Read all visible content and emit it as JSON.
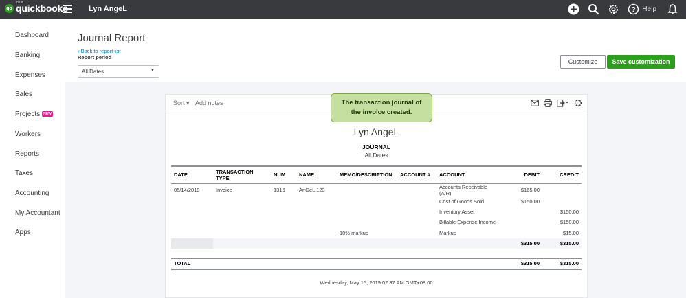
{
  "topbar": {
    "logo_intuit": "intuit",
    "logo_word": "quickbooks",
    "company_name": "Lyn AngeL",
    "help_label": "Help"
  },
  "sidebar": {
    "items": [
      {
        "label": "Dashboard"
      },
      {
        "label": "Banking"
      },
      {
        "label": "Expenses"
      },
      {
        "label": "Sales"
      },
      {
        "label": "Projects",
        "badge": "NEW"
      },
      {
        "label": "Workers"
      },
      {
        "label": "Reports"
      },
      {
        "label": "Taxes"
      },
      {
        "label": "Accounting"
      },
      {
        "label": "My Accountant"
      },
      {
        "label": "Apps"
      }
    ]
  },
  "header": {
    "title": "Journal Report",
    "back_link": "Back to report list",
    "report_period_label": "Report period",
    "period_value": "All Dates",
    "customize_label": "Customize",
    "save_label": "Save customization"
  },
  "toolbar": {
    "sort_label": "Sort",
    "add_notes_label": "Add notes"
  },
  "callout": {
    "line1": "The transaction  journal of",
    "line2": "the invoice created."
  },
  "report": {
    "company": "Lyn AngeL",
    "title": "JOURNAL",
    "dates": "All Dates",
    "columns": [
      "DATE",
      "TRANSACTION TYPE",
      "NUM",
      "NAME",
      "MEMO/DESCRIPTION",
      "ACCOUNT #",
      "ACCOUNT",
      "DEBIT",
      "CREDIT"
    ],
    "rows": [
      {
        "date": "05/14/2019",
        "type": "Invoice",
        "num": "1316",
        "name": "AnGeL 123",
        "memo": "",
        "acct_no": "",
        "account": "Accounts Receivable (A/R)",
        "debit": "$165.00",
        "credit": ""
      },
      {
        "date": "",
        "type": "",
        "num": "",
        "name": "",
        "memo": "",
        "acct_no": "",
        "account": "Cost of Goods Sold",
        "debit": "$150.00",
        "credit": ""
      },
      {
        "date": "",
        "type": "",
        "num": "",
        "name": "",
        "memo": "",
        "acct_no": "",
        "account": "Inventory Asset",
        "debit": "",
        "credit": "$150.00"
      },
      {
        "date": "",
        "type": "",
        "num": "",
        "name": "",
        "memo": "",
        "acct_no": "",
        "account": "Billable Expense Income",
        "debit": "",
        "credit": "$150.00"
      },
      {
        "date": "",
        "type": "",
        "num": "",
        "name": "",
        "memo": "10% markup",
        "acct_no": "",
        "account": "Markup",
        "debit": "",
        "credit": "$15.00"
      }
    ],
    "subtotal": {
      "debit": "$315.00",
      "credit": "$315.00"
    },
    "total": {
      "label": "TOTAL",
      "debit": "$315.00",
      "credit": "$315.00"
    },
    "timestamp": "Wednesday, May 15, 2019   02:37 AM GMT+08:00"
  }
}
